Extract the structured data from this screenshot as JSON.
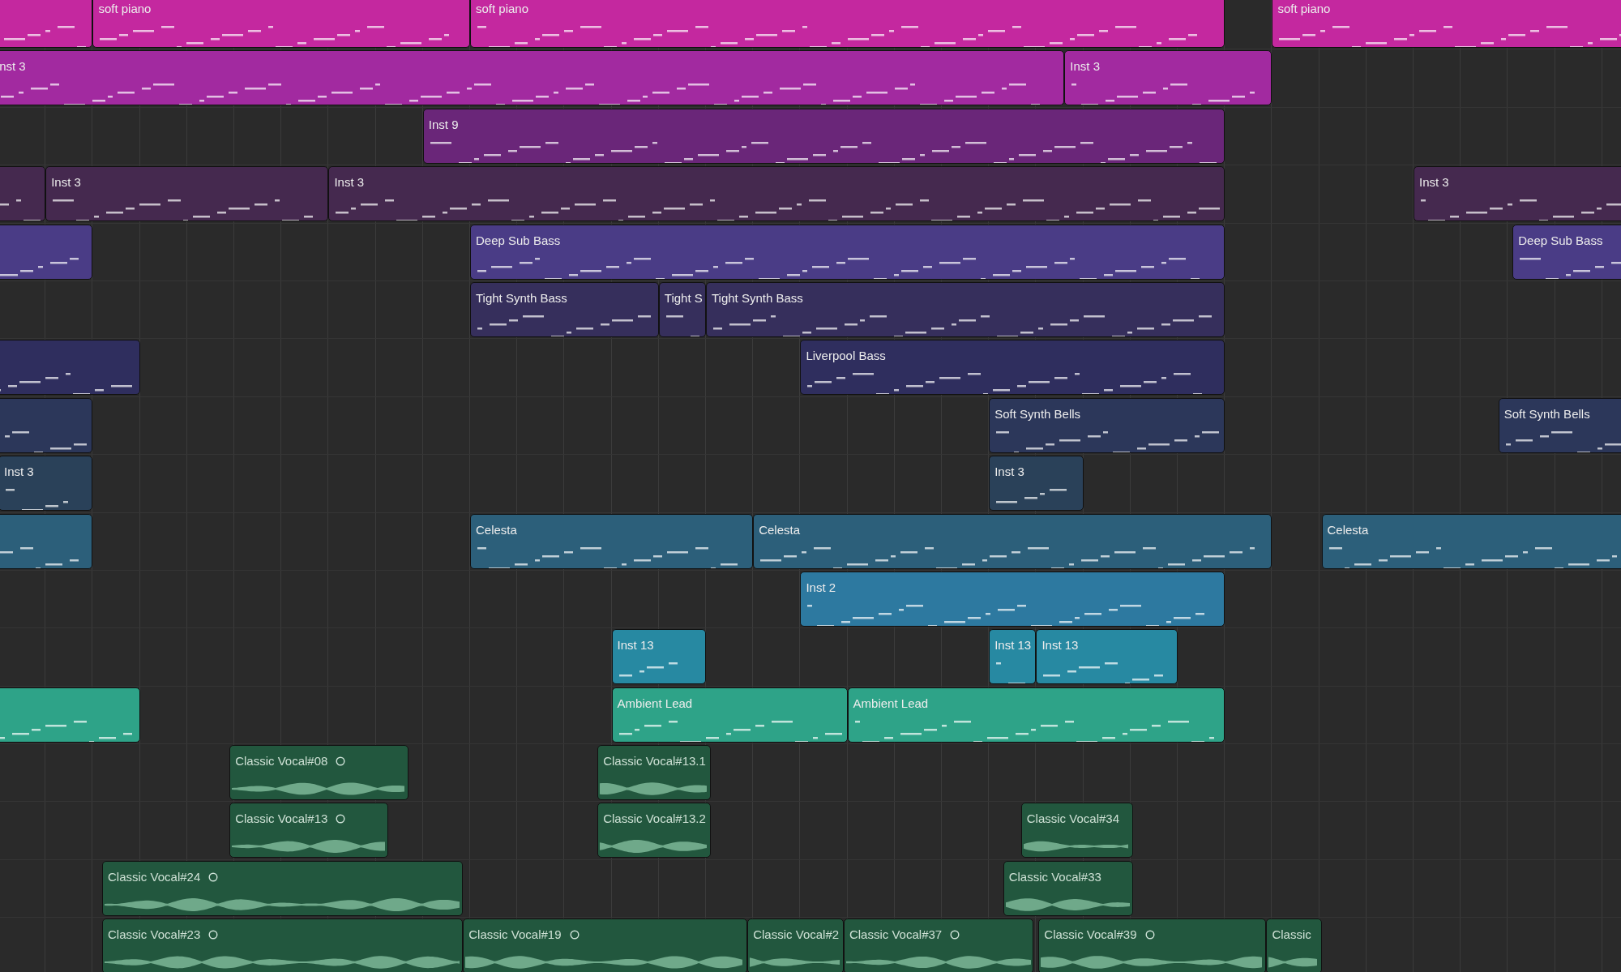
{
  "lanes": [
    {
      "color": "#c4289f",
      "regions": [
        {
          "kind": "midi"
        },
        {
          "kind": "midi",
          "name": "soft piano"
        },
        {
          "kind": "midi",
          "name": "soft piano"
        },
        {
          "kind": "midi",
          "name": "soft piano"
        }
      ]
    },
    {
      "color": "#a22aa0",
      "regions": [
        {
          "kind": "midi",
          "name": "nst 3"
        },
        {
          "kind": "midi",
          "name": "Inst 3"
        }
      ]
    },
    {
      "color": "#6a2679",
      "regions": [
        {
          "kind": "midi",
          "name": "Inst 9"
        }
      ]
    },
    {
      "color": "#45294f",
      "regions": [
        {
          "kind": "midi"
        },
        {
          "kind": "midi",
          "name": "Inst 3"
        },
        {
          "kind": "midi",
          "name": "Inst 3"
        },
        {
          "kind": "midi",
          "name": "Inst 3"
        }
      ]
    },
    {
      "color": "#4a3c86",
      "regions": [
        {
          "kind": "midi"
        },
        {
          "kind": "midi",
          "name": "Deep Sub Bass"
        },
        {
          "kind": "midi",
          "name": "Deep Sub Bass"
        }
      ]
    },
    {
      "color": "#362f5c",
      "regions": [
        {
          "kind": "midi",
          "name": "Tight Synth Bass"
        },
        {
          "kind": "midi",
          "name": "Tight S"
        },
        {
          "kind": "midi",
          "name": "Tight Synth Bass"
        }
      ]
    },
    {
      "color": "#2f2e5e",
      "regions": [
        {
          "kind": "midi"
        },
        {
          "kind": "midi",
          "name": "Liverpool Bass"
        }
      ]
    },
    {
      "color": "#2c375a",
      "regions": [
        {
          "kind": "midi"
        },
        {
          "kind": "midi",
          "name": "Soft Synth Bells"
        },
        {
          "kind": "midi",
          "name": "Soft Synth Bells"
        }
      ]
    },
    {
      "color": "#2a4159",
      "regions": [
        {
          "kind": "midi",
          "name": "Inst 3"
        },
        {
          "kind": "midi",
          "name": "Inst 3"
        }
      ]
    },
    {
      "color": "#2c5f7a",
      "regions": [
        {
          "kind": "midi"
        },
        {
          "kind": "midi",
          "name": "Celesta"
        },
        {
          "kind": "midi",
          "name": "Celesta"
        },
        {
          "kind": "midi",
          "name": "Celesta"
        }
      ]
    },
    {
      "color": "#2d79a0",
      "regions": [
        {
          "kind": "midi",
          "name": "Inst 2"
        }
      ]
    },
    {
      "color": "#2789a2",
      "regions": [
        {
          "kind": "midi",
          "name": "Inst 13"
        },
        {
          "kind": "midi",
          "name": "Inst 13"
        },
        {
          "kind": "midi",
          "name": "Inst 13"
        }
      ]
    },
    {
      "color": "#2ea388",
      "regions": [
        {
          "kind": "midi"
        },
        {
          "kind": "midi",
          "name": "Ambient Lead"
        },
        {
          "kind": "midi",
          "name": "Ambient Lead"
        }
      ]
    },
    {
      "color": "#22573e",
      "regions": [
        {
          "kind": "audio",
          "name": "Classic Vocal#08",
          "ring": true
        },
        {
          "kind": "audio",
          "name": "Classic Vocal#13.1",
          "ring": false
        }
      ]
    },
    {
      "color": "#22573e",
      "regions": [
        {
          "kind": "audio",
          "name": "Classic Vocal#13",
          "ring": true
        },
        {
          "kind": "audio",
          "name": "Classic Vocal#13.2",
          "ring": false
        },
        {
          "kind": "audio",
          "name": "Classic Vocal#34",
          "ring": false
        }
      ]
    },
    {
      "color": "#22573e",
      "regions": [
        {
          "kind": "audio",
          "name": "Classic Vocal#24",
          "ring": true
        },
        {
          "kind": "audio",
          "name": "Classic Vocal#33",
          "ring": false
        }
      ]
    },
    {
      "color": "#22573e",
      "regions": [
        {
          "kind": "audio",
          "name": "Classic Vocal#23",
          "ring": true
        },
        {
          "kind": "audio",
          "name": "Classic Vocal#19",
          "ring": true
        },
        {
          "kind": "audio",
          "name": "Classic Vocal#2",
          "ring": false
        },
        {
          "kind": "audio",
          "name": "Classic Vocal#37",
          "ring": true
        },
        {
          "kind": "audio",
          "name": "Classic Vocal#39",
          "ring": true
        },
        {
          "kind": "audio",
          "name": "Classic",
          "ring": false
        }
      ]
    }
  ]
}
